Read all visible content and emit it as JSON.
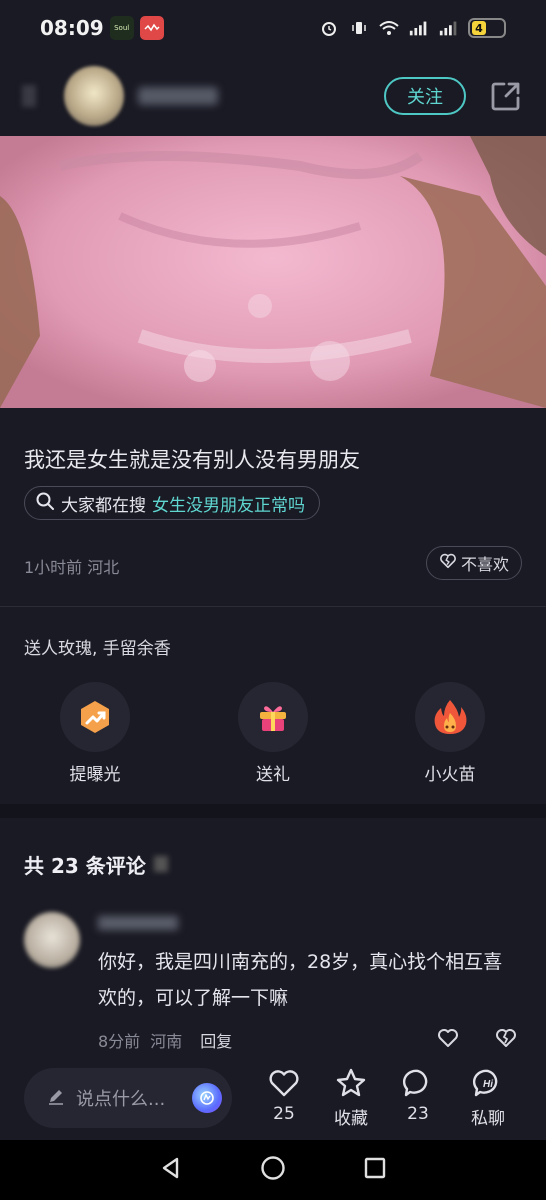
{
  "status_bar": {
    "time": "08:09",
    "app_icons": [
      "Soul",
      "music-app"
    ],
    "battery_level": "4"
  },
  "header": {
    "follow_label": "关注"
  },
  "post": {
    "text": "我还是女生就是没有别人没有男朋友",
    "search_prefix": "大家都在搜",
    "search_term": "女生没男朋友正常吗",
    "meta": "1小时前 河北",
    "dislike_label": "不喜欢"
  },
  "gifts": {
    "caption": "送人玫瑰, 手留余香",
    "items": [
      {
        "label": "提曝光",
        "icon": "boost-icon"
      },
      {
        "label": "送礼",
        "icon": "gift-icon"
      },
      {
        "label": "小火苗",
        "icon": "flame-icon"
      }
    ]
  },
  "comments": {
    "title": "共 23 条评论",
    "items": [
      {
        "text": "你好，我是四川南充的，28岁，真心找个相互喜欢的，可以了解一下嘛",
        "time": "8分前",
        "location": "河南",
        "reply_label": "回复"
      }
    ]
  },
  "action_bar": {
    "input_placeholder": "说点什么...",
    "like_count": "25",
    "favorite_label": "收藏",
    "comment_count": "23",
    "message_label": "私聊"
  },
  "colors": {
    "accent": "#5fd6d0",
    "background": "#1a1a24"
  }
}
